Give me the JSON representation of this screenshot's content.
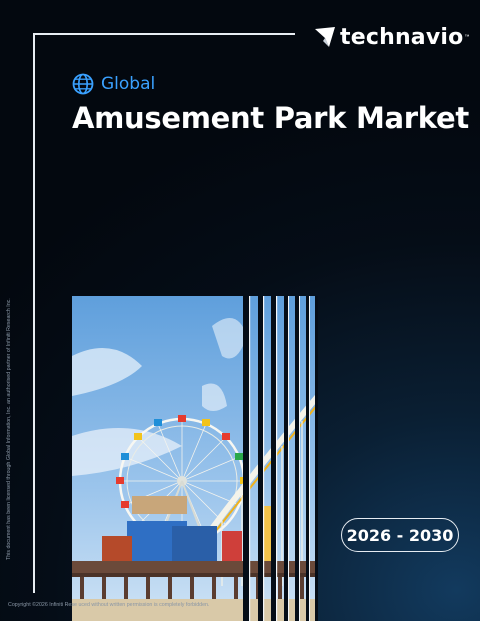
{
  "brand": {
    "name": "technavio",
    "tm": "™",
    "icon": "technavio-arrow-icon"
  },
  "report": {
    "region_icon": "globe-icon",
    "region": "Global",
    "title": "Amusement Park Market",
    "years": "2026 - 2030"
  },
  "image": {
    "subject": "ferris-wheel-pier-photo"
  },
  "legal": {
    "side_note": "This document has been licensed through Global Information, Inc. an authorised partner of Infiniti Research Inc.",
    "copyright": "Copyright ©2026 Infiniti Rese                                                                                                  uced without written permission is completely forbidden."
  },
  "colors": {
    "accent": "#3aa1ff",
    "background": "#050d17",
    "frame": "#e8edf2"
  }
}
